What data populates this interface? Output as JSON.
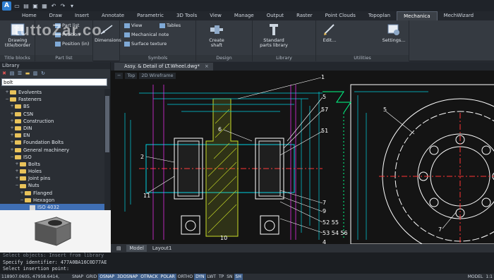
{
  "ribbon_tabs": [
    "Home",
    "Draw",
    "Insert",
    "Annotate",
    "Parametric",
    "3D Tools",
    "View",
    "Manage",
    "Output",
    "Raster",
    "Point Clouds",
    "Topoplan",
    "Mechanica",
    "MechWizard"
  ],
  "active_tab": "Mechanica",
  "ribbon": {
    "title_blocks": {
      "button": "Drawing title/border",
      "panel": "Title blocks"
    },
    "part_list": {
      "items": [
        "Part list",
        "Position",
        "Position (in)"
      ],
      "panel": "Part list"
    },
    "dimensions": {
      "button": "Dimensions"
    },
    "symbols": {
      "items": [
        "View",
        "Mechanical note",
        "Surface texture"
      ],
      "panel": "Symbols"
    },
    "tables": {
      "items": [
        "Tables"
      ]
    },
    "design": {
      "button": "Create shaft",
      "panel": "Design"
    },
    "library": {
      "button": "Standard parts library",
      "panel": "Library"
    },
    "utilities": {
      "buttons": [
        "Edit...",
        "Settings..."
      ],
      "panel": "Utilities"
    }
  },
  "library": {
    "title": "Library",
    "search_value": "bolt",
    "tree": [
      {
        "label": "Evolvents",
        "level": 1,
        "expander": "+"
      },
      {
        "label": "Fasteners",
        "level": 1,
        "expander": "−"
      },
      {
        "label": "BS",
        "level": 2,
        "expander": "+"
      },
      {
        "label": "CSN",
        "level": 2,
        "expander": "+"
      },
      {
        "label": "Construction",
        "level": 2,
        "expander": "+"
      },
      {
        "label": "DIN",
        "level": 2,
        "expander": "+"
      },
      {
        "label": "EN",
        "level": 2,
        "expander": "+"
      },
      {
        "label": "Foundation Bolts",
        "level": 2,
        "expander": "+"
      },
      {
        "label": "General machinery",
        "level": 2,
        "expander": "+"
      },
      {
        "label": "ISO",
        "level": 2,
        "expander": "−"
      },
      {
        "label": "Bolts",
        "level": 3,
        "expander": "+"
      },
      {
        "label": "Holes",
        "level": 3,
        "expander": "+"
      },
      {
        "label": "Joint pins",
        "level": 3,
        "expander": "+"
      },
      {
        "label": "Nuts",
        "level": 3,
        "expander": "−"
      },
      {
        "label": "Flanged",
        "level": 4,
        "expander": "+"
      },
      {
        "label": "Hexagon",
        "level": 4,
        "expander": "−"
      },
      {
        "label": "ISO 4032",
        "level": 5,
        "expander": "",
        "selected": true,
        "leaf": true
      }
    ]
  },
  "document": {
    "tab_title": "Assy. & Detail of LT.Wheel.dwg*",
    "view_controls": [
      "−",
      "Top",
      "2D Wireframe"
    ],
    "layout_tabs": [
      "Model",
      "Layout1"
    ],
    "labels": [
      "1",
      "2",
      "5",
      "57",
      "51",
      "6",
      "7",
      "9",
      "52 55",
      "53 54 56",
      "4",
      "10",
      "11",
      "5",
      "7"
    ]
  },
  "command": {
    "lines": [
      "Select objects: Insert from library",
      "Specify identifier: 477A0BA16C0D77AE",
      "Select insertion point:"
    ]
  },
  "status": {
    "coords": "118907.0605, 47958.6414, 0.0000",
    "toggles": [
      "SNAP",
      "GRID",
      "OSNAP",
      "3DOSNAP",
      "OTRACK",
      "POLAR",
      "ORTHO",
      "DYN",
      "LWT",
      "TP",
      "SN",
      "SH"
    ],
    "active": [
      "OSNAP",
      "3DOSNAP",
      "OTRACK",
      "POLAR",
      "DYN",
      "SH"
    ],
    "model": "MODEL",
    "zoom": "1:1"
  },
  "watermark": "tuttoZar.co"
}
